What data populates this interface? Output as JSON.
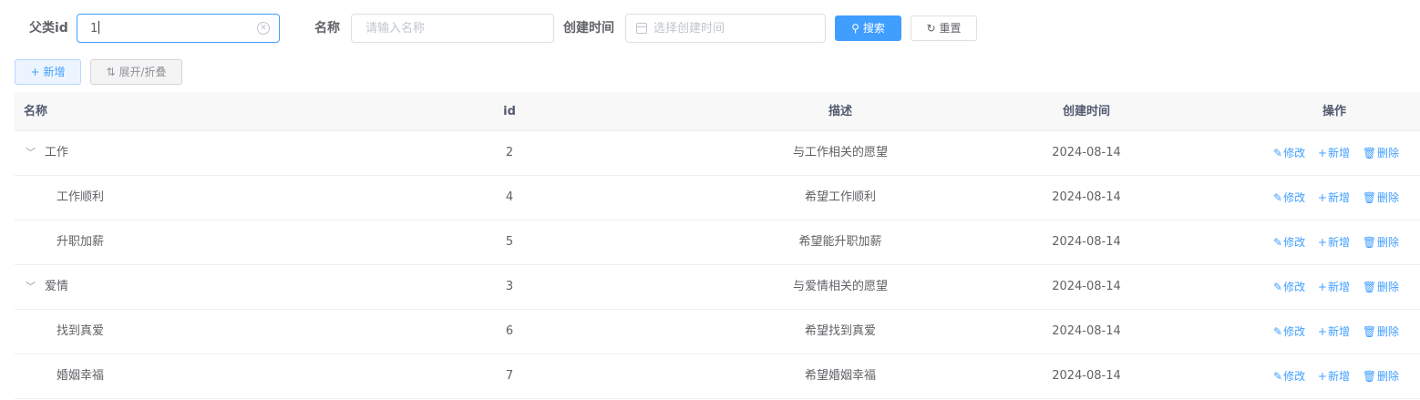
{
  "search": {
    "parent_id_label": "父类id",
    "parent_id_value": "1",
    "name_label": "名称",
    "name_placeholder": "请输入名称",
    "created_label": "创建时间",
    "created_placeholder": "选择创建时间",
    "search_button": "搜索",
    "reset_button": "重置"
  },
  "toolbar": {
    "add_button": "新增",
    "toggle_button": "展开/折叠"
  },
  "table": {
    "columns": [
      "名称",
      "id",
      "描述",
      "创建时间",
      "操作"
    ],
    "actions": {
      "edit": "修改",
      "add": "新增",
      "delete": "删除"
    },
    "rows": [
      {
        "name": "工作",
        "id": "2",
        "desc": "与工作相关的愿望",
        "created": "2024-08-14",
        "level": 0,
        "expanded": true
      },
      {
        "name": "工作顺利",
        "id": "4",
        "desc": "希望工作顺利",
        "created": "2024-08-14",
        "level": 1,
        "expanded": false
      },
      {
        "name": "升职加薪",
        "id": "5",
        "desc": "希望能升职加薪",
        "created": "2024-08-14",
        "level": 1,
        "expanded": false
      },
      {
        "name": "爱情",
        "id": "3",
        "desc": "与爱情相关的愿望",
        "created": "2024-08-14",
        "level": 0,
        "expanded": true
      },
      {
        "name": "找到真爱",
        "id": "6",
        "desc": "希望找到真爱",
        "created": "2024-08-14",
        "level": 1,
        "expanded": false
      },
      {
        "name": "婚姻幸福",
        "id": "7",
        "desc": "希望婚姻幸福",
        "created": "2024-08-14",
        "level": 1,
        "expanded": false
      }
    ]
  },
  "colors": {
    "primary": "#409eff",
    "header_bg": "#f8f8f9",
    "border": "#ebeef5"
  }
}
